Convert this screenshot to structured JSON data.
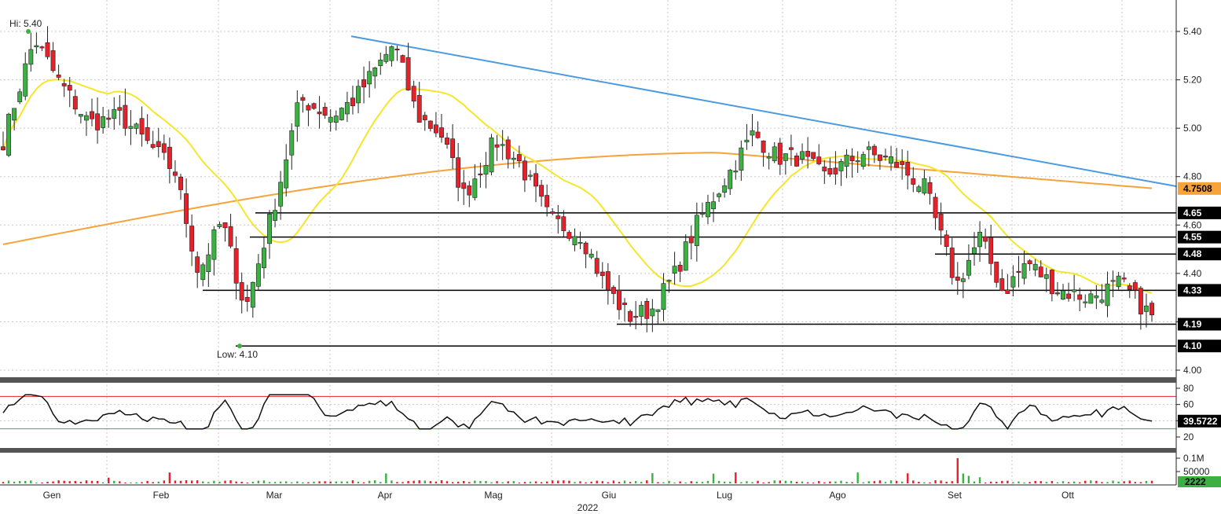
{
  "chart_data": {
    "type": "candlestick",
    "year": "2022",
    "months": [
      "Gen",
      "Feb",
      "Mar",
      "Apr",
      "Mag",
      "Giu",
      "Lug",
      "Ago",
      "Set",
      "Ott"
    ],
    "price": {
      "yticks": [
        4.0,
        4.2,
        4.4,
        4.6,
        4.8,
        5.0,
        5.2,
        5.4
      ],
      "ylim": [
        3.97,
        5.52
      ],
      "hi_label": "Hi: 5.40",
      "low_label": "Low: 4.10",
      "hi_value": 5.4,
      "low_value": 4.1,
      "levels": [
        {
          "value": 4.65,
          "label": "4.65"
        },
        {
          "value": 4.55,
          "label": "4.55"
        },
        {
          "value": 4.48,
          "label": "4.48"
        },
        {
          "value": 4.33,
          "label": "4.33"
        },
        {
          "value": 4.19,
          "label": "4.19"
        },
        {
          "value": 4.1,
          "label": "4.10"
        }
      ],
      "ma_slow_label": "4.7508",
      "ma_slow_value": 4.7508,
      "trendline": {
        "start": 5.38,
        "end": 4.76
      },
      "colors": {
        "up": "#3cb043",
        "down": "#e8202a",
        "ma_fast": "#f5e62a",
        "ma_slow": "#f5a33a",
        "trend": "#4a9be0",
        "level": "#000000"
      }
    },
    "rsi": {
      "yticks": [
        20,
        40,
        60,
        80
      ],
      "current_label": "39.5722",
      "current": 39.57,
      "overbought": 70,
      "oversold": 30
    },
    "volume": {
      "yticks": [
        "0.1M",
        "50000"
      ],
      "current_label": "2222"
    }
  }
}
